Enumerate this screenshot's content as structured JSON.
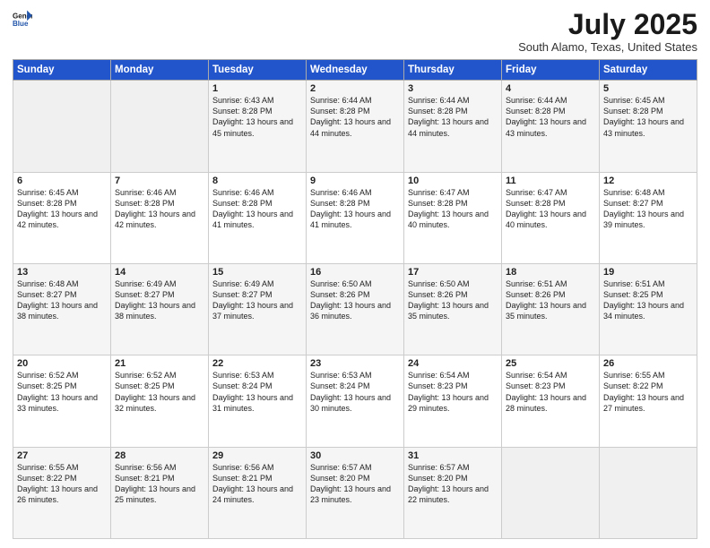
{
  "header": {
    "logo_general": "General",
    "logo_blue": "Blue",
    "title": "July 2025",
    "subtitle": "South Alamo, Texas, United States"
  },
  "calendar": {
    "days_of_week": [
      "Sunday",
      "Monday",
      "Tuesday",
      "Wednesday",
      "Thursday",
      "Friday",
      "Saturday"
    ],
    "weeks": [
      [
        {
          "day": "",
          "sunrise": "",
          "sunset": "",
          "daylight": ""
        },
        {
          "day": "",
          "sunrise": "",
          "sunset": "",
          "daylight": ""
        },
        {
          "day": "1",
          "sunrise": "Sunrise: 6:43 AM",
          "sunset": "Sunset: 8:28 PM",
          "daylight": "Daylight: 13 hours and 45 minutes."
        },
        {
          "day": "2",
          "sunrise": "Sunrise: 6:44 AM",
          "sunset": "Sunset: 8:28 PM",
          "daylight": "Daylight: 13 hours and 44 minutes."
        },
        {
          "day": "3",
          "sunrise": "Sunrise: 6:44 AM",
          "sunset": "Sunset: 8:28 PM",
          "daylight": "Daylight: 13 hours and 44 minutes."
        },
        {
          "day": "4",
          "sunrise": "Sunrise: 6:44 AM",
          "sunset": "Sunset: 8:28 PM",
          "daylight": "Daylight: 13 hours and 43 minutes."
        },
        {
          "day": "5",
          "sunrise": "Sunrise: 6:45 AM",
          "sunset": "Sunset: 8:28 PM",
          "daylight": "Daylight: 13 hours and 43 minutes."
        }
      ],
      [
        {
          "day": "6",
          "sunrise": "Sunrise: 6:45 AM",
          "sunset": "Sunset: 8:28 PM",
          "daylight": "Daylight: 13 hours and 42 minutes."
        },
        {
          "day": "7",
          "sunrise": "Sunrise: 6:46 AM",
          "sunset": "Sunset: 8:28 PM",
          "daylight": "Daylight: 13 hours and 42 minutes."
        },
        {
          "day": "8",
          "sunrise": "Sunrise: 6:46 AM",
          "sunset": "Sunset: 8:28 PM",
          "daylight": "Daylight: 13 hours and 41 minutes."
        },
        {
          "day": "9",
          "sunrise": "Sunrise: 6:46 AM",
          "sunset": "Sunset: 8:28 PM",
          "daylight": "Daylight: 13 hours and 41 minutes."
        },
        {
          "day": "10",
          "sunrise": "Sunrise: 6:47 AM",
          "sunset": "Sunset: 8:28 PM",
          "daylight": "Daylight: 13 hours and 40 minutes."
        },
        {
          "day": "11",
          "sunrise": "Sunrise: 6:47 AM",
          "sunset": "Sunset: 8:28 PM",
          "daylight": "Daylight: 13 hours and 40 minutes."
        },
        {
          "day": "12",
          "sunrise": "Sunrise: 6:48 AM",
          "sunset": "Sunset: 8:27 PM",
          "daylight": "Daylight: 13 hours and 39 minutes."
        }
      ],
      [
        {
          "day": "13",
          "sunrise": "Sunrise: 6:48 AM",
          "sunset": "Sunset: 8:27 PM",
          "daylight": "Daylight: 13 hours and 38 minutes."
        },
        {
          "day": "14",
          "sunrise": "Sunrise: 6:49 AM",
          "sunset": "Sunset: 8:27 PM",
          "daylight": "Daylight: 13 hours and 38 minutes."
        },
        {
          "day": "15",
          "sunrise": "Sunrise: 6:49 AM",
          "sunset": "Sunset: 8:27 PM",
          "daylight": "Daylight: 13 hours and 37 minutes."
        },
        {
          "day": "16",
          "sunrise": "Sunrise: 6:50 AM",
          "sunset": "Sunset: 8:26 PM",
          "daylight": "Daylight: 13 hours and 36 minutes."
        },
        {
          "day": "17",
          "sunrise": "Sunrise: 6:50 AM",
          "sunset": "Sunset: 8:26 PM",
          "daylight": "Daylight: 13 hours and 35 minutes."
        },
        {
          "day": "18",
          "sunrise": "Sunrise: 6:51 AM",
          "sunset": "Sunset: 8:26 PM",
          "daylight": "Daylight: 13 hours and 35 minutes."
        },
        {
          "day": "19",
          "sunrise": "Sunrise: 6:51 AM",
          "sunset": "Sunset: 8:25 PM",
          "daylight": "Daylight: 13 hours and 34 minutes."
        }
      ],
      [
        {
          "day": "20",
          "sunrise": "Sunrise: 6:52 AM",
          "sunset": "Sunset: 8:25 PM",
          "daylight": "Daylight: 13 hours and 33 minutes."
        },
        {
          "day": "21",
          "sunrise": "Sunrise: 6:52 AM",
          "sunset": "Sunset: 8:25 PM",
          "daylight": "Daylight: 13 hours and 32 minutes."
        },
        {
          "day": "22",
          "sunrise": "Sunrise: 6:53 AM",
          "sunset": "Sunset: 8:24 PM",
          "daylight": "Daylight: 13 hours and 31 minutes."
        },
        {
          "day": "23",
          "sunrise": "Sunrise: 6:53 AM",
          "sunset": "Sunset: 8:24 PM",
          "daylight": "Daylight: 13 hours and 30 minutes."
        },
        {
          "day": "24",
          "sunrise": "Sunrise: 6:54 AM",
          "sunset": "Sunset: 8:23 PM",
          "daylight": "Daylight: 13 hours and 29 minutes."
        },
        {
          "day": "25",
          "sunrise": "Sunrise: 6:54 AM",
          "sunset": "Sunset: 8:23 PM",
          "daylight": "Daylight: 13 hours and 28 minutes."
        },
        {
          "day": "26",
          "sunrise": "Sunrise: 6:55 AM",
          "sunset": "Sunset: 8:22 PM",
          "daylight": "Daylight: 13 hours and 27 minutes."
        }
      ],
      [
        {
          "day": "27",
          "sunrise": "Sunrise: 6:55 AM",
          "sunset": "Sunset: 8:22 PM",
          "daylight": "Daylight: 13 hours and 26 minutes."
        },
        {
          "day": "28",
          "sunrise": "Sunrise: 6:56 AM",
          "sunset": "Sunset: 8:21 PM",
          "daylight": "Daylight: 13 hours and 25 minutes."
        },
        {
          "day": "29",
          "sunrise": "Sunrise: 6:56 AM",
          "sunset": "Sunset: 8:21 PM",
          "daylight": "Daylight: 13 hours and 24 minutes."
        },
        {
          "day": "30",
          "sunrise": "Sunrise: 6:57 AM",
          "sunset": "Sunset: 8:20 PM",
          "daylight": "Daylight: 13 hours and 23 minutes."
        },
        {
          "day": "31",
          "sunrise": "Sunrise: 6:57 AM",
          "sunset": "Sunset: 8:20 PM",
          "daylight": "Daylight: 13 hours and 22 minutes."
        },
        {
          "day": "",
          "sunrise": "",
          "sunset": "",
          "daylight": ""
        },
        {
          "day": "",
          "sunrise": "",
          "sunset": "",
          "daylight": ""
        }
      ]
    ]
  }
}
